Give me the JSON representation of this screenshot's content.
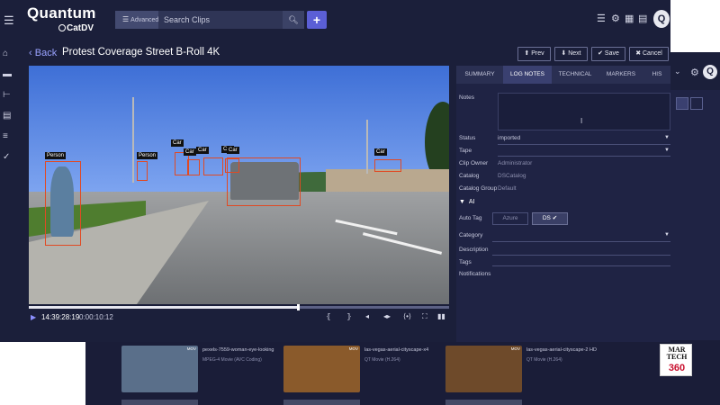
{
  "app": {
    "brand": "Quantum",
    "product": "CatDV"
  },
  "search": {
    "advanced_label": "Advanced",
    "placeholder": "Search Clips"
  },
  "clip": {
    "back_label": "Back",
    "title": "Protest Coverage Street B-Roll 4K"
  },
  "actions": {
    "prev": "Prev",
    "next": "Next",
    "save": "Save",
    "cancel": "Cancel"
  },
  "player": {
    "timecode": "14:39:28:19",
    "duration": "0:00:10:12",
    "progress_fraction": 0.64
  },
  "detections": [
    "Person",
    "Person",
    "Car",
    "Car",
    "Car",
    "Car",
    "Car",
    "Car"
  ],
  "tabs": [
    "SUMMARY",
    "LOG NOTES",
    "TECHNICAL",
    "MARKERS",
    "HIS"
  ],
  "active_tab": "LOG NOTES",
  "fields": {
    "notes_label": "Notes",
    "status_label": "Status",
    "status_value": "imported",
    "tape_label": "Tape",
    "clip_owner_label": "Clip Owner",
    "clip_owner_value": "Administrator",
    "catalog_label": "Catalog",
    "catalog_value": "DSCatalog",
    "catalog_group_label": "Catalog Group",
    "catalog_group_value": "Default"
  },
  "ai": {
    "heading": "AI",
    "auto_tag_label": "Auto Tag",
    "azure_label": "Azure",
    "ds_label": "DS",
    "category_label": "Category",
    "description_label": "Description",
    "tags_label": "Tags",
    "notifications_label": "Notifications"
  },
  "browse_clips": [
    {
      "name": "pexels-7559-woman-eye-looking",
      "format": "MPEG-4 Movie (AVC Coding)",
      "badge": "MOV",
      "color": "#5a6f8a"
    },
    {
      "name": "las-vegas-aerial-cityscape-x4",
      "format": "QT Movie (H.264)",
      "badge": "MOV",
      "color": "#8a5a2b"
    },
    {
      "name": "las-vegas-aerial-cityscape-2 HD",
      "format": "QT Movie (H.264)",
      "badge": "MOV",
      "color": "#6e4a2a"
    }
  ],
  "watermark": {
    "line1": "MAR",
    "line2": "TECH",
    "line3": "360"
  },
  "colors": {
    "background": "#1b1f3a",
    "accent": "#5b5fd6",
    "bbox": "#e04a24"
  }
}
